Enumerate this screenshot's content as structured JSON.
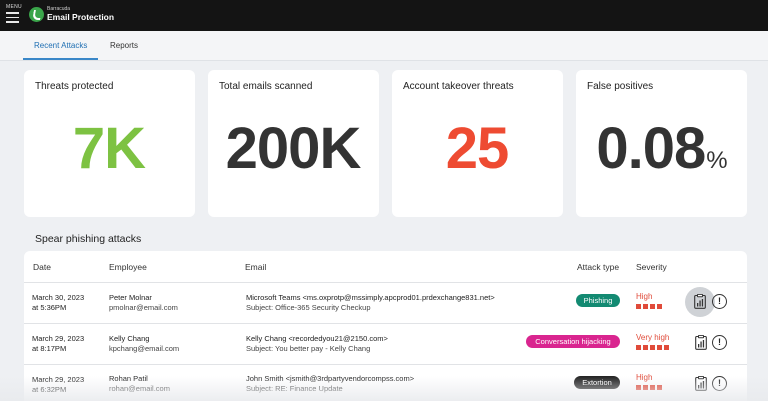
{
  "header": {
    "menu_label": "MENU",
    "brand": "Barracuda",
    "product": "Email Protection"
  },
  "tabs": [
    {
      "label": "Recent Attacks",
      "active": true
    },
    {
      "label": "Reports",
      "active": false
    }
  ],
  "stats": [
    {
      "label": "Threats protected",
      "value": "7K",
      "unit": "",
      "color": "#7dc242"
    },
    {
      "label": "Total emails scanned",
      "value": "200K",
      "unit": "",
      "color": "#333333"
    },
    {
      "label": "Account takeover threats",
      "value": "25",
      "unit": "",
      "color": "#ee4b32"
    },
    {
      "label": "False positives",
      "value": "0.08",
      "unit": "%",
      "color": "#333333"
    }
  ],
  "table": {
    "title": "Spear phishing attacks",
    "columns": [
      "Date",
      "Employee",
      "Email",
      "Attack type",
      "Severity"
    ],
    "rows": [
      {
        "date": "March 30, 2023",
        "time": "at 5:36PM",
        "employee_name": "Peter Molnar",
        "employee_email": "pmolnar@email.com",
        "email_from": "Microsoft Teams <ms.oxprotp@mssimply.apcprod01.prdexchange831.net>",
        "email_subject": "Subject: Office-365 Security Checkup",
        "attack_type": "Phishing",
        "attack_color": "#138a72",
        "severity": "High",
        "severity_level": 4
      },
      {
        "date": "March 29, 2023",
        "time": "at 8:17PM",
        "employee_name": "Kelly Chang",
        "employee_email": "kpchang@email.com",
        "email_from": "Kelly Chang <recordedyou21@2150.com>",
        "email_subject": "Subject: You better pay - Kelly Chang",
        "attack_type": "Conversation hijacking",
        "attack_color": "#d9258f",
        "severity": "Very high",
        "severity_level": 5
      },
      {
        "date": "March 29, 2023",
        "time": "at 6:32PM",
        "employee_name": "Rohan Patil",
        "employee_email": "rohan@email.com",
        "email_from": "John Smith <jsmith@3rdpartyvendorcompss.com>",
        "email_subject": "Subject: RE: Finance Update",
        "attack_type": "Extortion",
        "attack_color": "#222222",
        "severity": "High",
        "severity_level": 4
      }
    ],
    "alert_symbol": "!"
  },
  "colors": {
    "topbar": "#141414",
    "accent": "#3a87c8",
    "severity": "#e04b3a"
  }
}
